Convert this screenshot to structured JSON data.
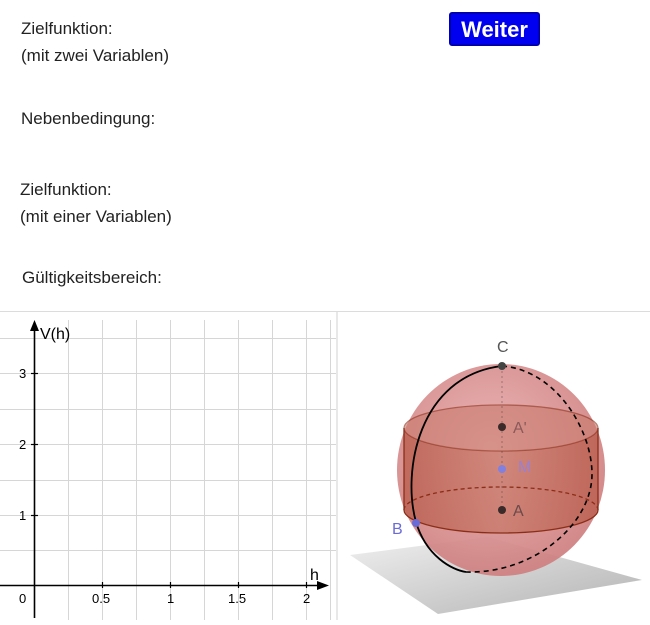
{
  "panel": {
    "zielfunktion_zwei_1": "Zielfunktion:",
    "zielfunktion_zwei_2": "(mit zwei Variablen)",
    "nebenbedingung": "Nebenbedingung:",
    "zielfunktion_einer_1": "Zielfunktion:",
    "zielfunktion_einer_2": "(mit einer Variablen)",
    "gueltigkeitsbereich": "Gültigkeitsbereich:",
    "weiter_button": "Weiter"
  },
  "graph": {
    "y_axis_label": "V(h)",
    "x_axis_label": "h",
    "origin_label": "0",
    "x_ticks": [
      "0.5",
      "1",
      "1.5",
      "2"
    ],
    "y_ticks": [
      "1",
      "2",
      "3"
    ]
  },
  "view3d": {
    "points": [
      "C",
      "A'",
      "M",
      "A",
      "B"
    ],
    "colors": {
      "sphere": "#d98080",
      "cylinder": "#b5522e",
      "point_dark": "#444444",
      "point_blue": "#6b6bd8"
    }
  }
}
